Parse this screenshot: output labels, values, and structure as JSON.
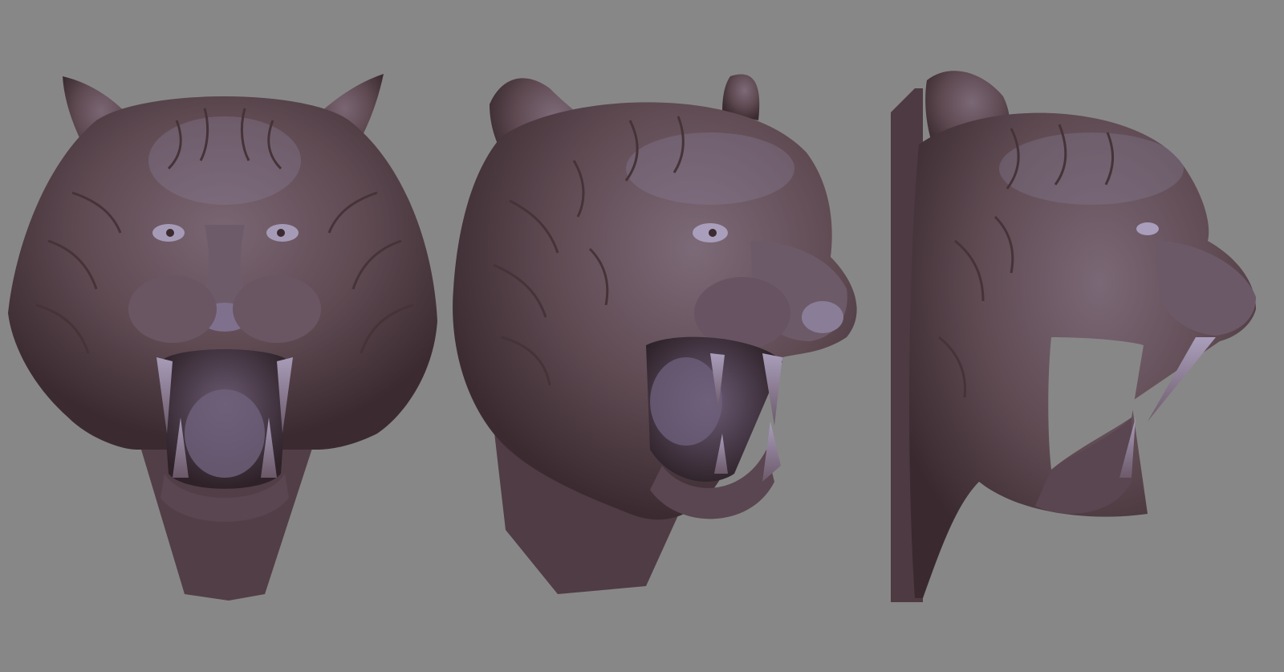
{
  "scene": {
    "background_color": "#878787",
    "material_colors": {
      "base": "#5f4a52",
      "shadow": "#3b2b31",
      "highlight": "#9a8fae",
      "rim": "#b7b0c8",
      "stripe": "#453338"
    },
    "views": [
      {
        "id": "front",
        "subject": "tiger-head-sculpt"
      },
      {
        "id": "three-quarter",
        "subject": "tiger-head-sculpt"
      },
      {
        "id": "profile",
        "subject": "tiger-head-sculpt"
      }
    ]
  }
}
